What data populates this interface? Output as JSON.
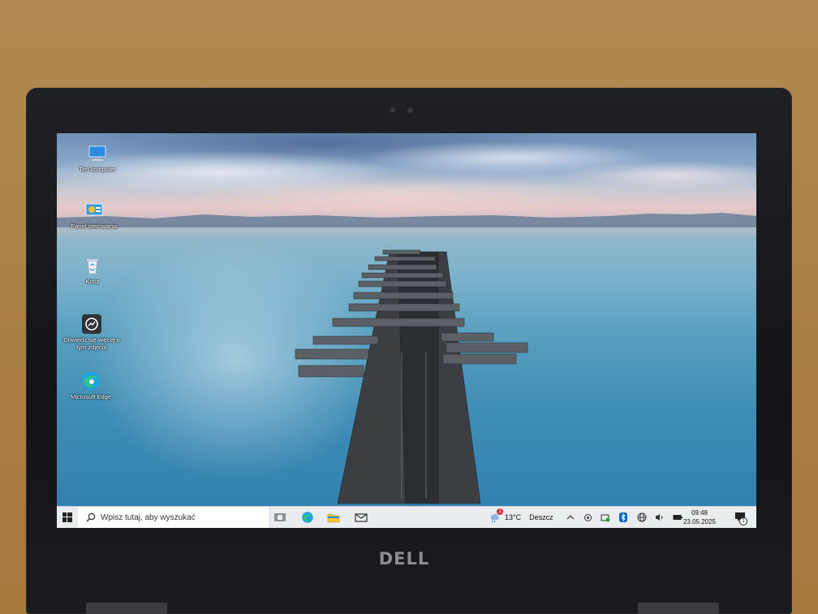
{
  "brand": {
    "logo_text": "DELL"
  },
  "desktop": {
    "icons": [
      {
        "label": "Ten komputer",
        "icon": "this-pc-icon"
      },
      {
        "label": "Panel sterowania",
        "icon": "control-panel-icon"
      },
      {
        "label": "Kosz",
        "icon": "recycle-bin-icon"
      },
      {
        "label": "Dowiedz się więcej o tym zdjęciu",
        "icon": "learn-about-picture-icon"
      },
      {
        "label": "Microsoft Edge",
        "icon": "edge-icon"
      }
    ]
  },
  "taskbar": {
    "search_placeholder": "Wpisz tutaj, aby wyszukać",
    "pinned": [
      "task-view-icon",
      "edge-icon",
      "file-explorer-icon",
      "mail-icon"
    ],
    "weather": {
      "temp": "13°C",
      "condition": "Deszcz",
      "badge": "1"
    },
    "tray_icons": [
      "chevron-up-icon",
      "meet-now-icon",
      "security-icon",
      "bluetooth-icon",
      "network-icon",
      "volume-icon",
      "battery-icon"
    ],
    "clock": {
      "time": "09:48",
      "date": "23.05.2025"
    },
    "notifications_badge": "1"
  },
  "colors": {
    "taskbar_bg": "#e9edf1",
    "accent": "#0a66c2",
    "edge": "#1ea4e0"
  }
}
